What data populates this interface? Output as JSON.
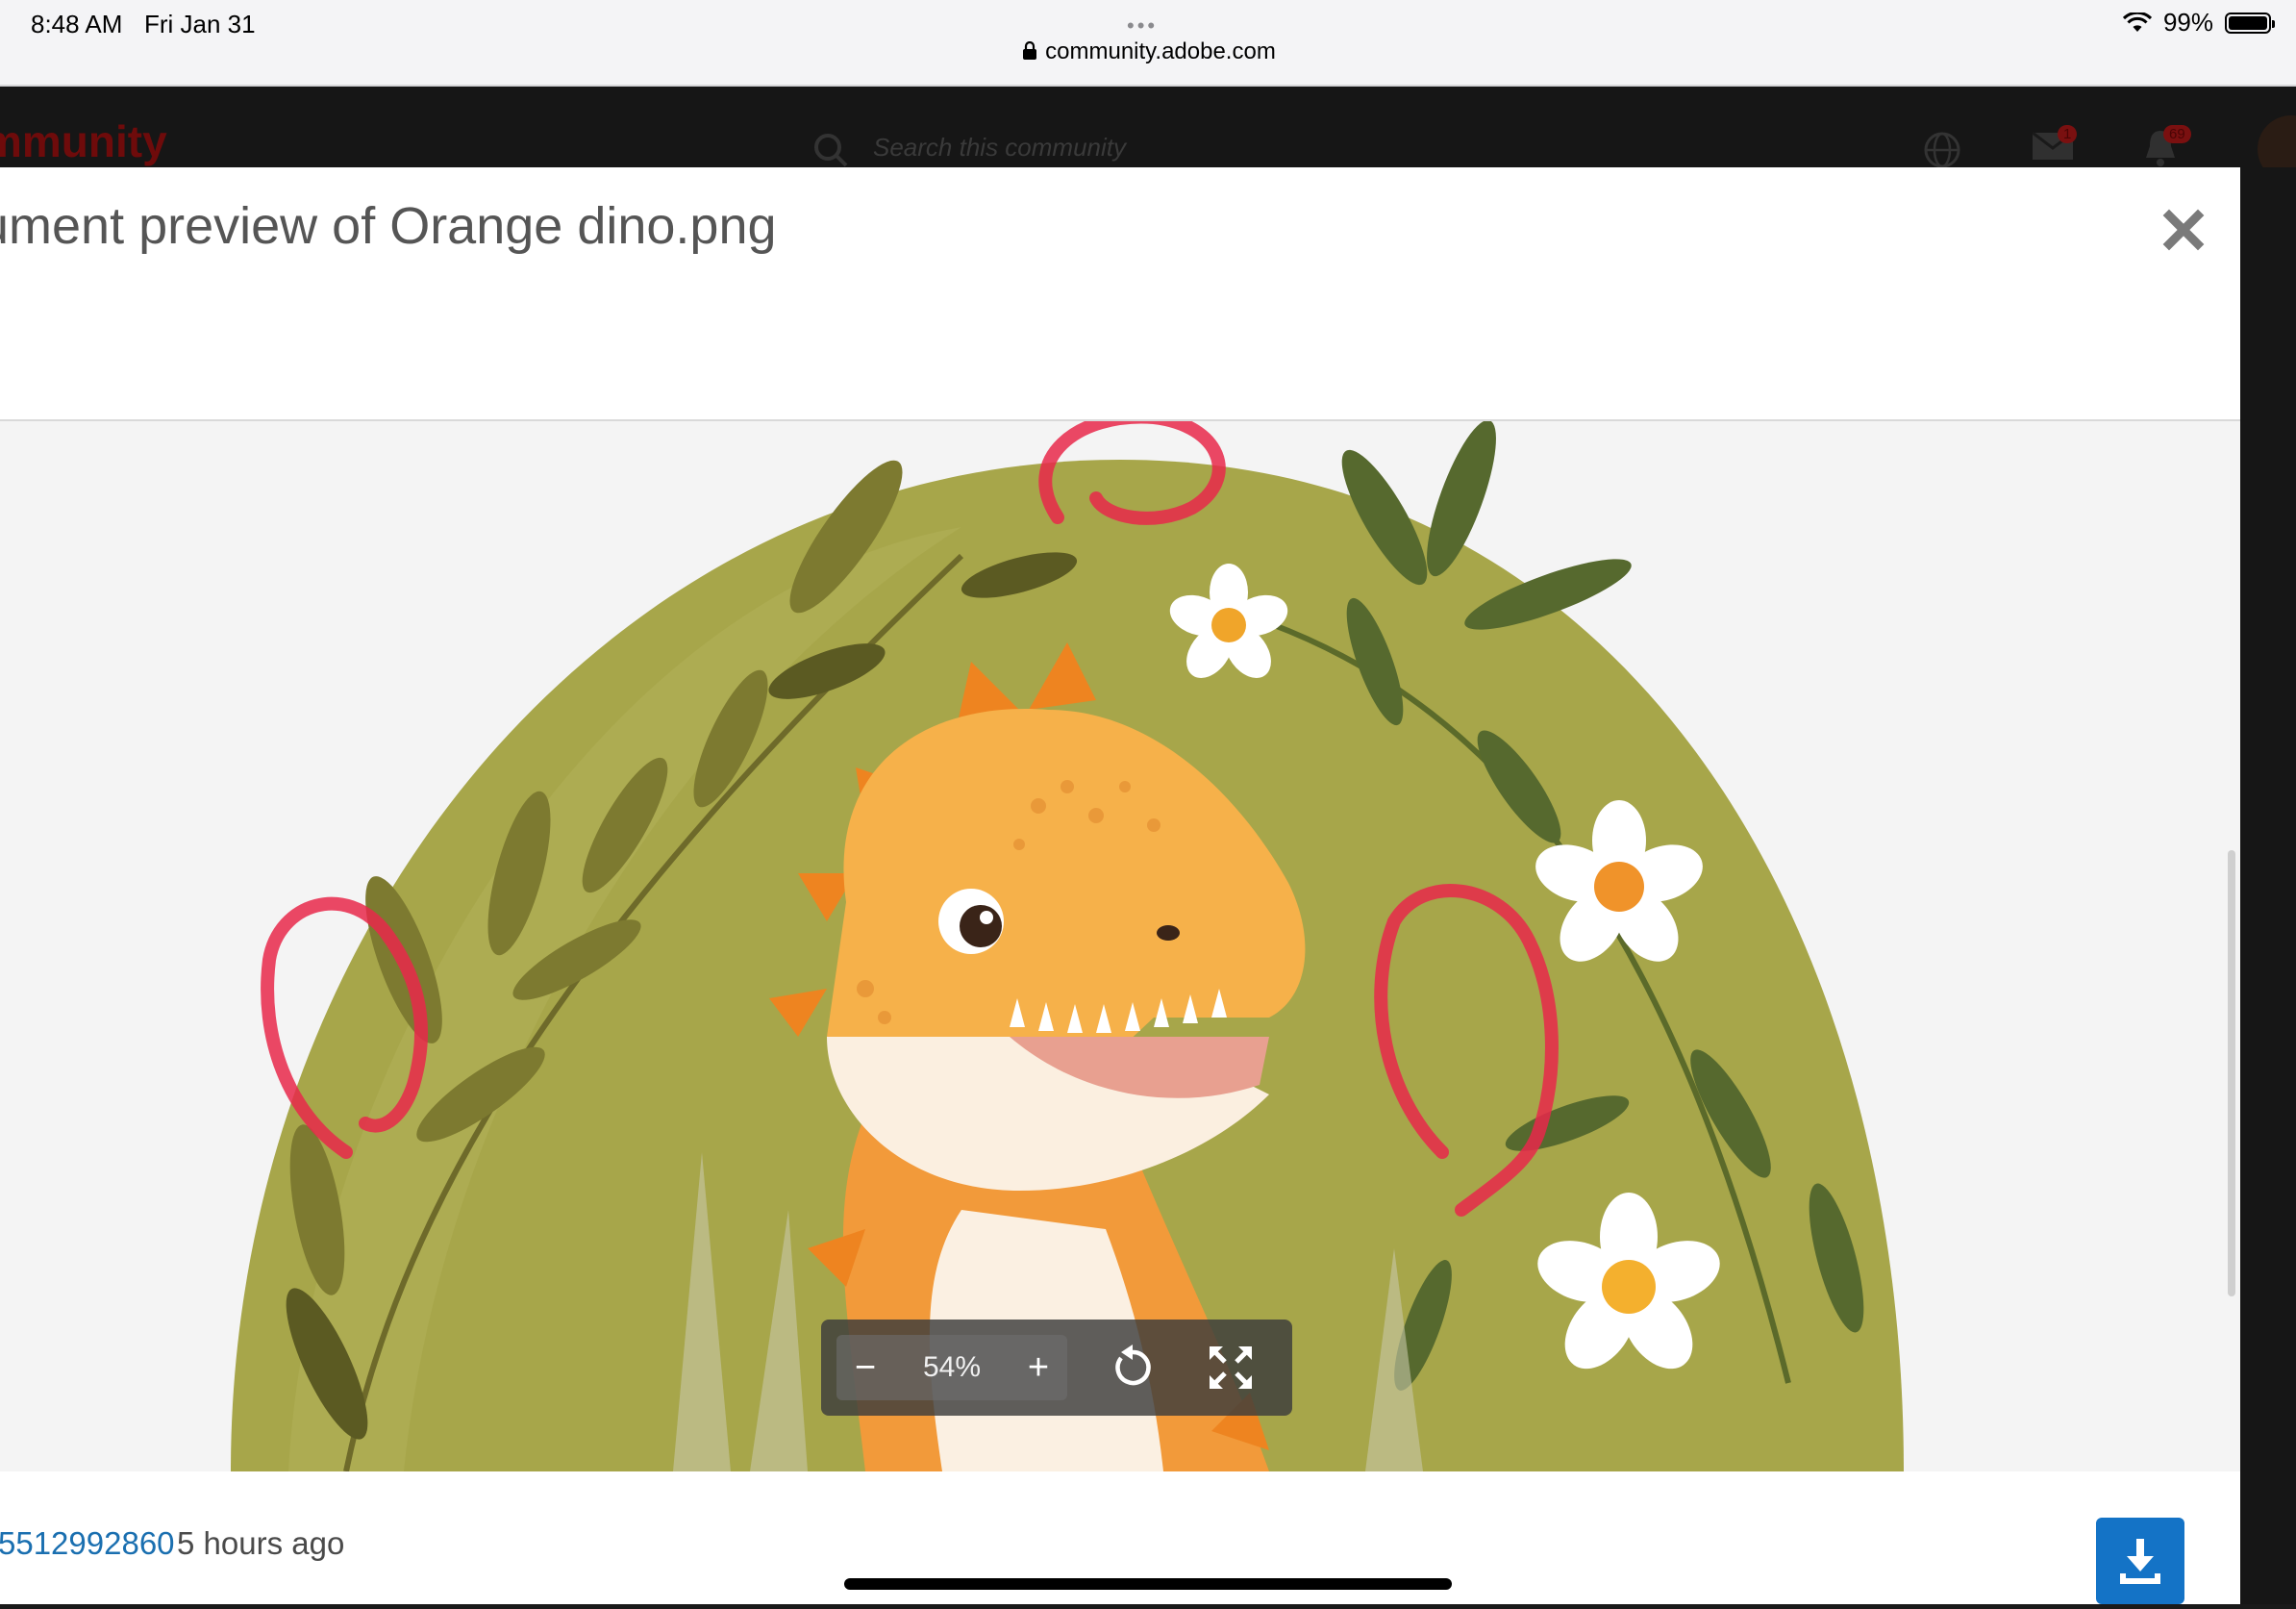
{
  "status_bar": {
    "time": "8:48 AM",
    "date": "Fri Jan 31",
    "battery": "99%",
    "battery_level": 0.99,
    "url": "community.adobe.com",
    "dots": "•••"
  },
  "community": {
    "brand": "mmunity",
    "search_placeholder": "Search this community",
    "mail_count": "1",
    "notifications_count": "69"
  },
  "modal": {
    "title": "cument preview of Orange dino.png",
    "zoom_level": "54%",
    "zoom_minus": "−",
    "zoom_plus": "+",
    "author": "5512992860",
    "posted": "5 hours ago"
  },
  "colors": {
    "accent": "#1473c6",
    "link": "#1a6fb0",
    "annotation": "#e8284a",
    "dino_orange": "#f29a3a",
    "hill_green": "#a7a64a"
  },
  "icons": {
    "close": "close-icon",
    "download": "download-icon",
    "rotate": "rotate-icon",
    "fit": "fit-screen-icon"
  }
}
